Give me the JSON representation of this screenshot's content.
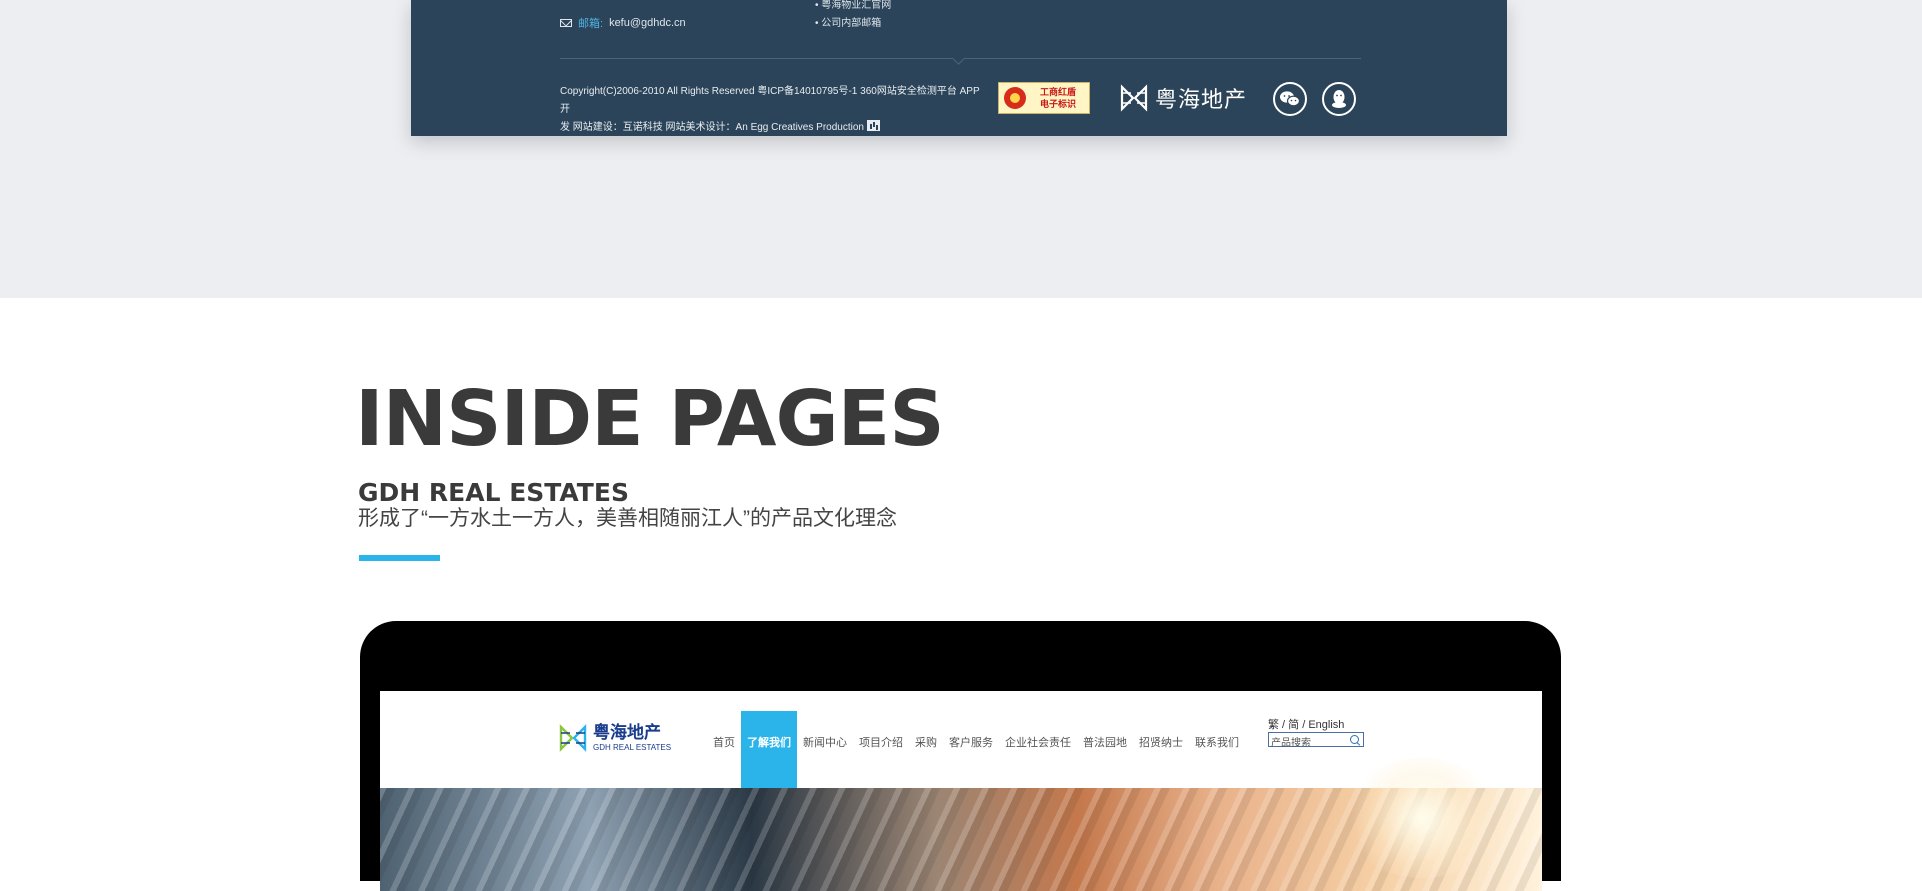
{
  "footer": {
    "mail_label": "邮箱:",
    "mail_value": "kefu@gdhdc.cn",
    "links": [
      "粤海物业汇官网",
      "公司内部邮箱"
    ],
    "copyright_line1": "Copyright(C)2006-2010 All Rights Reserved 粤ICP备14010795号-1  360网站安全检测平台 APP开",
    "copyright_line2": "发 网站建设：互诺科技   网站美术设计：An Egg Creatives Production",
    "badge_line1": "工商红盾",
    "badge_line2": "电子标识",
    "logo_text": "粤海地产",
    "social_icons": [
      "wechat-icon",
      "qq-icon"
    ]
  },
  "section": {
    "title": "INSIDE PAGES",
    "subtitle": "GDH REAL ESTATES",
    "description": "形成了“一方水土一方人，美善相随丽江人”的产品文化理念"
  },
  "site": {
    "logo_cn": "粤海地产",
    "logo_en": "GDH REAL ESTATES",
    "nav": [
      "首页",
      "了解我们",
      "新闻中心",
      "项目介绍",
      "采购",
      "客户服务",
      "企业社会责任",
      "普法园地",
      "招贤纳士",
      "联系我们"
    ],
    "active_nav": "了解我们",
    "lang_switch": "繁 / 简 / English",
    "search_placeholder": "产品搜索"
  },
  "colors": {
    "footer_bg": "#2b4459",
    "accent": "#2ab4ea",
    "page_band": "#eceef2",
    "title_text": "#3a3a3a"
  }
}
